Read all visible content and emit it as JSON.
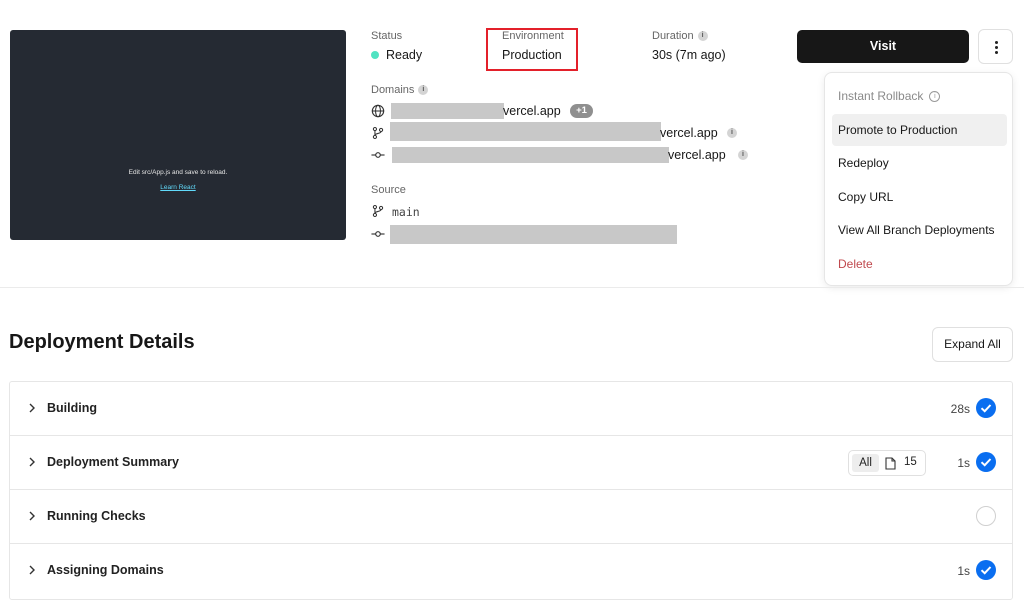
{
  "preview": {
    "text": "Edit src/App.js and save to reload.",
    "link": "Learn React"
  },
  "status": {
    "label": "Status",
    "value": "Ready",
    "color": "#50e3c2"
  },
  "environment": {
    "label": "Environment",
    "value": "Production",
    "highlight_color": "#e3202a"
  },
  "duration": {
    "label": "Duration",
    "value": "30s (7m ago)",
    "info_icon": "info-icon"
  },
  "domains": {
    "label": "Domains",
    "items": [
      {
        "icon": "globe-icon",
        "suffix": "vercel.app",
        "badge": "+1"
      },
      {
        "icon": "git-branch-icon",
        "suffix": "vercel.app"
      },
      {
        "icon": "git-commit-icon",
        "suffix": "vercel.app"
      }
    ]
  },
  "source": {
    "label": "Source",
    "branch": "main",
    "branch_icon": "git-branch-icon",
    "commit_icon": "git-commit-icon"
  },
  "actions": {
    "visit_label": "Visit",
    "more_icon": "more-vertical-icon"
  },
  "menu": {
    "items": [
      {
        "label": "Instant Rollback",
        "state": "disabled"
      },
      {
        "label": "Promote to Production",
        "state": "hover"
      },
      {
        "label": "Redeploy",
        "state": "normal"
      },
      {
        "label": "Copy URL",
        "state": "normal"
      },
      {
        "label": "View All Branch Deployments",
        "state": "normal"
      },
      {
        "label": "Delete",
        "state": "danger"
      }
    ]
  },
  "details": {
    "title": "Deployment Details",
    "expand_label": "Expand All",
    "rows": [
      {
        "label": "Building",
        "time": "28s",
        "status": "complete"
      },
      {
        "label": "Deployment Summary",
        "time": "1s",
        "status": "complete",
        "filter": "All",
        "file_count": "15"
      },
      {
        "label": "Running Checks",
        "time": "",
        "status": "pending"
      },
      {
        "label": "Assigning Domains",
        "time": "1s",
        "status": "complete"
      }
    ]
  },
  "colors": {
    "accent": "#0a6ef0",
    "danger": "#c0494e",
    "button_dark": "#171717"
  }
}
